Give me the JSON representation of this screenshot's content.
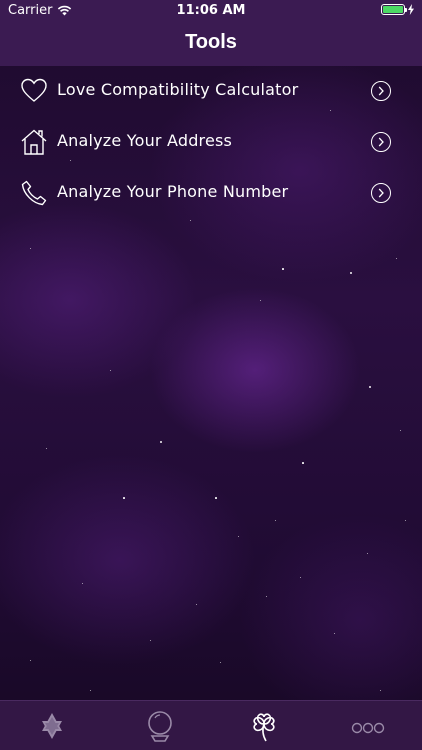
{
  "status_bar": {
    "carrier": "Carrier",
    "time": "11:06 AM",
    "battery_color": "#4cd964"
  },
  "header": {
    "title": "Tools"
  },
  "menu": {
    "items": [
      {
        "label": "Love Compatibility Calculator",
        "icon": "heart-icon"
      },
      {
        "label": "Analyze Your Address",
        "icon": "house-icon"
      },
      {
        "label": "Analyze Your Phone Number",
        "icon": "phone-icon"
      }
    ]
  },
  "tab_bar": {
    "tabs": [
      {
        "icon": "star-of-david-icon",
        "selected": false
      },
      {
        "icon": "crystal-ball-icon",
        "selected": false
      },
      {
        "icon": "four-leaf-clover-icon",
        "selected": true
      },
      {
        "icon": "more-dots-icon",
        "selected": false
      }
    ]
  },
  "colors": {
    "bar_background": "#3b1b52",
    "tab_bar_background": "#331745",
    "accent": "#ffffff"
  }
}
